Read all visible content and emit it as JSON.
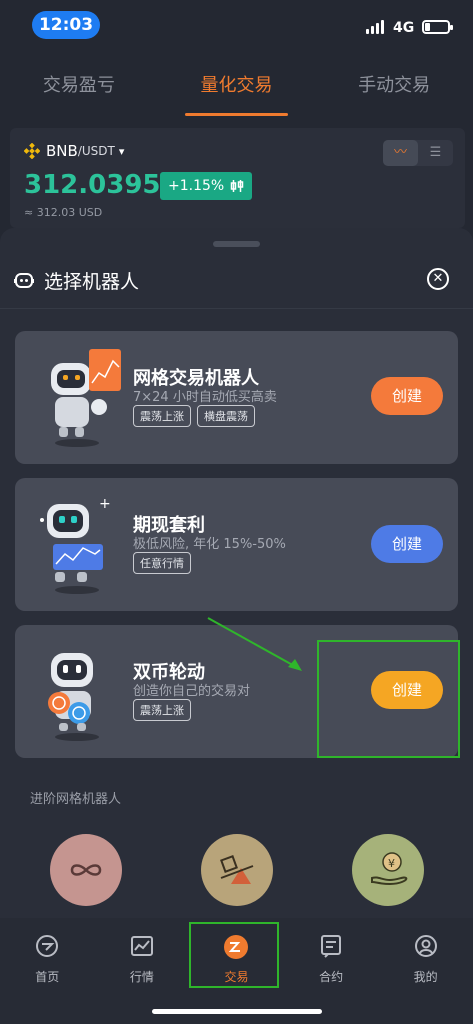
{
  "status_bar": {
    "time": "12:03",
    "network": "4G"
  },
  "top_tabs": [
    {
      "label": "交易盈亏"
    },
    {
      "label": "量化交易"
    },
    {
      "label": "手动交易"
    }
  ],
  "ticker": {
    "base": "BNB",
    "quote": "/USDT",
    "caret": "▾",
    "price": "312.0395",
    "change": "+1.15%",
    "price_usd": "≈ 312.03 USD"
  },
  "sheet": {
    "title": "选择机器人",
    "cards": [
      {
        "name": "网格交易机器人",
        "desc": "7×24 小时自动低买高卖",
        "tags": [
          "震荡上涨",
          "横盘震荡"
        ],
        "button": "创建",
        "button_color": "#f47a3b"
      },
      {
        "name": "期现套利",
        "desc": "极低风险, 年化 15%-50%",
        "tags": [
          "任意行情"
        ],
        "button": "创建",
        "button_color": "#4e7be6"
      },
      {
        "name": "双币轮动",
        "desc": "创造你自己的交易对",
        "tags": [
          "震荡上涨"
        ],
        "button": "创建",
        "button_color": "#f5a623"
      }
    ],
    "section_label": "进阶网格机器人",
    "advanced": [
      {
        "icon": "infinity-icon",
        "color": "#c59590"
      },
      {
        "icon": "shapes-icon",
        "color": "#b8a47a"
      },
      {
        "icon": "yuan-hand-icon",
        "color": "#a6b27a"
      }
    ]
  },
  "bottom_nav": [
    {
      "label": "首页",
      "icon": "home-icon"
    },
    {
      "label": "行情",
      "icon": "chart-icon"
    },
    {
      "label": "交易",
      "icon": "trade-icon"
    },
    {
      "label": "合约",
      "icon": "contract-icon"
    },
    {
      "label": "我的",
      "icon": "profile-icon"
    }
  ],
  "colors": {
    "accent": "#f07b2f",
    "up": "#2cc39a",
    "annotation": "#2fb52b"
  }
}
